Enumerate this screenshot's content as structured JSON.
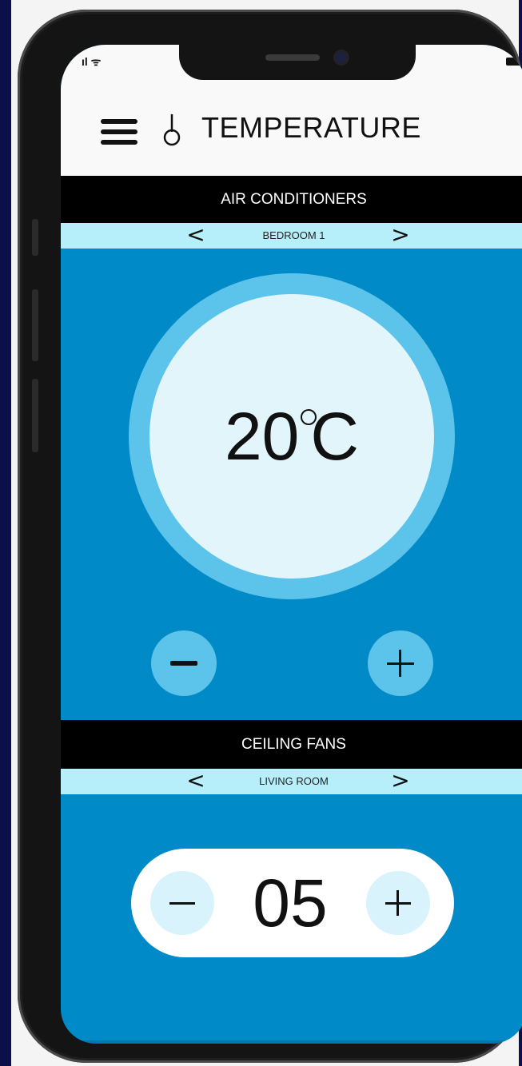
{
  "status": {
    "signal": "ıl ᯤ"
  },
  "header": {
    "title": "TEMPERATURE",
    "menu_icon": "hamburger-icon",
    "logo_icon": "thermometer-icon"
  },
  "air_conditioners": {
    "section_title": "AIR CONDITIONERS",
    "room": "BEDROOM 1",
    "prev_label": "<",
    "next_label": ">",
    "temperature": "20",
    "unit": "C",
    "decrease_icon": "minus-icon",
    "increase_icon": "plus-icon"
  },
  "ceiling_fans": {
    "section_title": "CEILING FANS",
    "room": "LIVING ROOM",
    "prev_label": "<",
    "next_label": ">",
    "speed": "05",
    "decrease_icon": "minus-icon",
    "increase_icon": "plus-icon"
  },
  "colors": {
    "accent": "#008ac8",
    "dial_ring": "#5cc3ea",
    "dial_face": "#e2f5fb",
    "room_bar": "#b6effa",
    "section_bar": "#000000"
  }
}
